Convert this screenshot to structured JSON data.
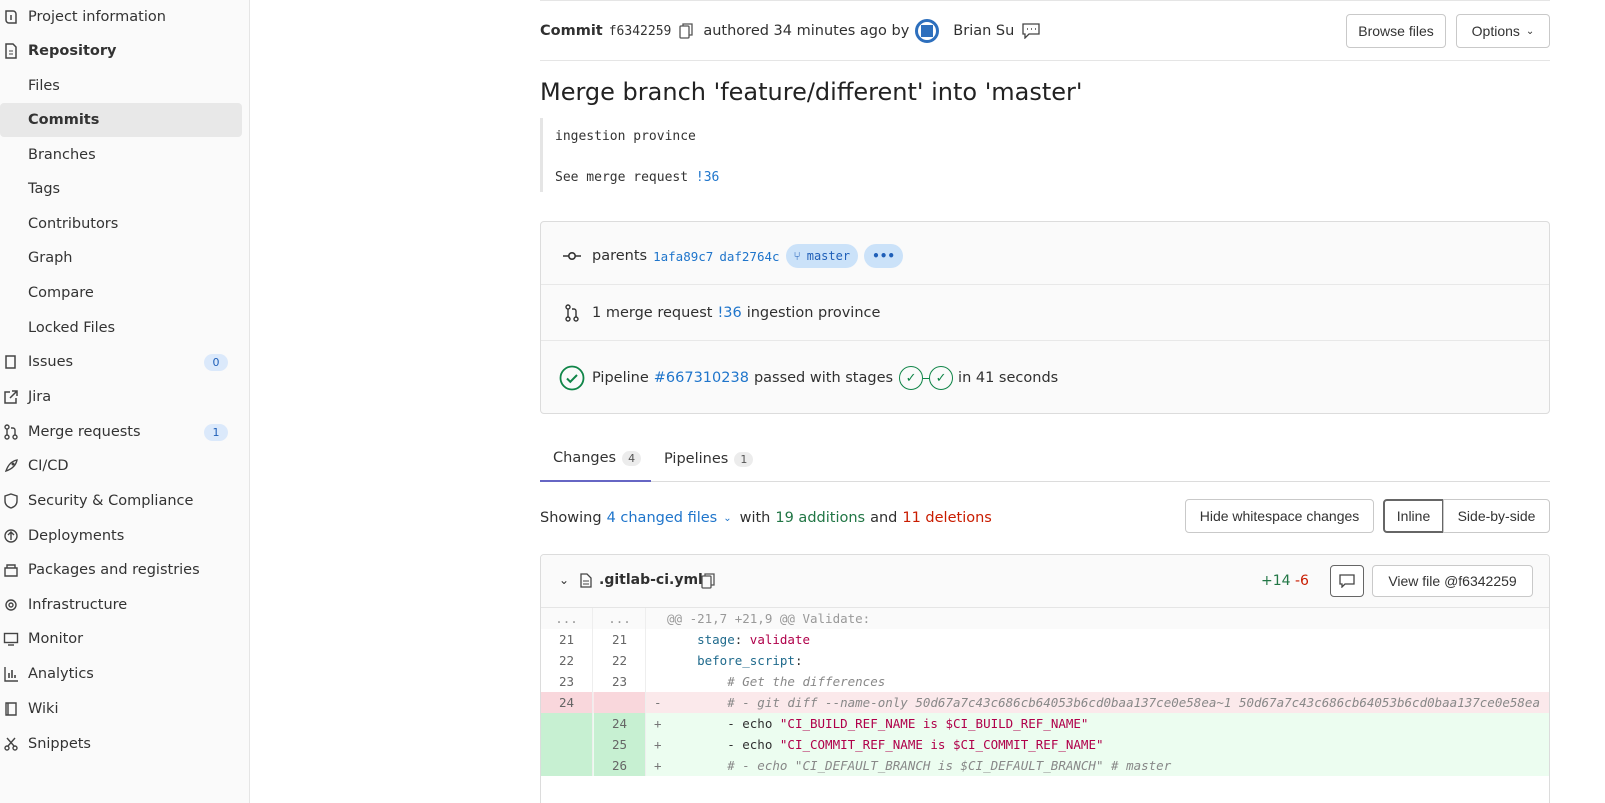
{
  "sidebar": {
    "items": [
      {
        "label": "Project information",
        "icon": "info-icon"
      },
      {
        "label": "Repository",
        "icon": "document-icon"
      },
      {
        "label": "Files"
      },
      {
        "label": "Commits"
      },
      {
        "label": "Branches"
      },
      {
        "label": "Tags"
      },
      {
        "label": "Contributors"
      },
      {
        "label": "Graph"
      },
      {
        "label": "Compare"
      },
      {
        "label": "Locked Files"
      },
      {
        "label": "Issues",
        "icon": "issues-icon",
        "badge": "0"
      },
      {
        "label": "Jira",
        "icon": "external-link-icon"
      },
      {
        "label": "Merge requests",
        "icon": "merge-request-icon",
        "badge": "1"
      },
      {
        "label": "CI/CD",
        "icon": "rocket-icon"
      },
      {
        "label": "Security & Compliance",
        "icon": "shield-icon"
      },
      {
        "label": "Deployments",
        "icon": "deployments-icon"
      },
      {
        "label": "Packages and registries",
        "icon": "package-icon"
      },
      {
        "label": "Infrastructure",
        "icon": "cloud-gear-icon"
      },
      {
        "label": "Monitor",
        "icon": "monitor-icon"
      },
      {
        "label": "Analytics",
        "icon": "chart-icon"
      },
      {
        "label": "Wiki",
        "icon": "book-icon"
      },
      {
        "label": "Snippets",
        "icon": "scissors-icon"
      }
    ]
  },
  "header": {
    "commit_word": "Commit",
    "sha": "f6342259",
    "authored": "authored 34 minutes ago by",
    "author": "Brian Su",
    "browse_files": "Browse files",
    "options": "Options"
  },
  "commit": {
    "title": "Merge branch 'feature/different' into 'master'",
    "desc_line1": "ingestion province",
    "desc_line2_prefix": "See merge request ",
    "desc_line2_link": "!36"
  },
  "info": {
    "parents_label": "parents",
    "parent1": "1afa89c7",
    "parent2": "daf2764c",
    "branch": "master",
    "more": "•••",
    "mr_prefix": "1 merge request",
    "mr_link": "!36",
    "mr_title": "ingestion province",
    "pipeline_label": "Pipeline",
    "pipeline_link": "#667310238",
    "pipeline_mid": "passed with stages",
    "pipeline_suffix": "in 41 seconds"
  },
  "tabs": [
    {
      "label": "Changes",
      "count": "4"
    },
    {
      "label": "Pipelines",
      "count": "1"
    }
  ],
  "summary": {
    "showing": "Showing",
    "changed": "4 changed files",
    "with": "with",
    "additions": "19 additions",
    "and": "and",
    "deletions": "11 deletions"
  },
  "diff_toolbar": {
    "hide_ws": "Hide whitespace changes",
    "inline": "Inline",
    "side": "Side-by-side"
  },
  "file": {
    "name": ".gitlab-ci.yml",
    "added": "+14",
    "removed": "-6",
    "view_file": "View file @f6342259"
  },
  "diff_lines": [
    {
      "type": "hunk",
      "old": "...",
      "new": "...",
      "mark": "",
      "code": "@@ -21,7 +21,9 @@ Validate:"
    },
    {
      "type": "ctx",
      "old": "21",
      "new": "21",
      "mark": "",
      "key": "    stage",
      "sep": ": ",
      "val": "validate"
    },
    {
      "type": "ctx",
      "old": "22",
      "new": "22",
      "mark": "",
      "key": "    before_script",
      "sep": ":",
      "val": ""
    },
    {
      "type": "ctx",
      "old": "23",
      "new": "23",
      "mark": "",
      "comment": "        # Get the differences"
    },
    {
      "type": "del",
      "old": "24",
      "new": "",
      "mark": "-",
      "comment": "        # - git diff --name-only 50d67a7c43c686cb64053b6cd0baa137ce0e58ea~1 50d67a7c43c686cb64053b6cd0baa137ce0e58ea"
    },
    {
      "type": "add",
      "old": "",
      "new": "24",
      "mark": "+",
      "plain": "        - echo ",
      "str": "\"CI_BUILD_REF_NAME is $CI_BUILD_REF_NAME\""
    },
    {
      "type": "add",
      "old": "",
      "new": "25",
      "mark": "+",
      "plain": "        - echo ",
      "str": "\"CI_COMMIT_REF_NAME is $CI_COMMIT_REF_NAME\""
    },
    {
      "type": "add",
      "old": "",
      "new": "26",
      "mark": "+",
      "comment": "        # - echo \"CI_DEFAULT_BRANCH is $CI_DEFAULT_BRANCH\" # master"
    }
  ],
  "colors": {
    "link": "#1f75cb",
    "success": "#108548",
    "additions": "#217645",
    "deletions": "#c91c00",
    "tab_active": "#6666c4"
  }
}
